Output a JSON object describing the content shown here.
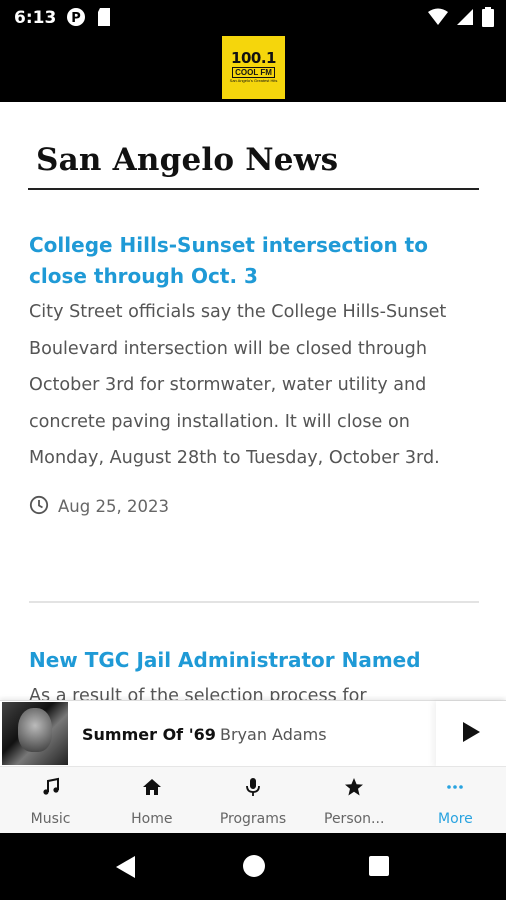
{
  "status_bar": {
    "time": "6:13"
  },
  "app": {
    "logo_number": "100.1",
    "logo_name": "COOL FM",
    "logo_tagline": "San Angelo's Greatest Hits"
  },
  "section": {
    "title": "San Angelo News"
  },
  "articles": [
    {
      "title": "College Hills-Sunset intersection to close through Oct. 3",
      "body": "City Street officials say the College Hills-Sunset Boulevard intersection will be closed through October 3rd for stormwater, water utility and concrete paving installation. It will close on Monday, August 28th to Tuesday, October 3rd.",
      "date": "Aug 25, 2023"
    },
    {
      "title": "New TGC Jail Administrator Named",
      "body": "As a result of the selection process for"
    }
  ],
  "now_playing": {
    "title": "Summer Of '69",
    "artist": "Bryan Adams"
  },
  "tabs": [
    {
      "label": "Music",
      "icon": "music-note-icon"
    },
    {
      "label": "Home",
      "icon": "home-icon"
    },
    {
      "label": "Programs",
      "icon": "microphone-icon"
    },
    {
      "label": "Person...",
      "icon": "star-icon"
    },
    {
      "label": "More",
      "icon": "more-dots-icon"
    }
  ],
  "colors": {
    "accent": "#1f9ad6",
    "logo_yellow": "#f5d60c",
    "active_tab": "#29a3e0"
  }
}
